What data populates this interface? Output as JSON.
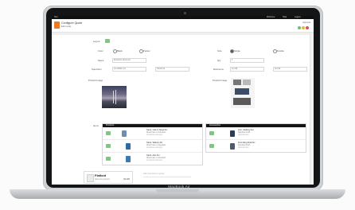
{
  "device": {
    "brand": "MacBook Air"
  },
  "topbar": {
    "left": "Hub",
    "right_items": [
      "Welcome",
      "Help",
      "Logout"
    ]
  },
  "header": {
    "title": "Configure Quote",
    "subtitle": "Edit mode",
    "right_label": "Approval",
    "accent_colors": [
      "#6fbf73",
      "#e6b83a",
      "#d9534f"
    ]
  },
  "form": {
    "row1": {
      "label": "Layout",
      "toggle": ""
    },
    "row2": {
      "label": "Color",
      "options": [
        "Black",
        "Pewter"
      ],
      "right_label": "Size",
      "right_options": [
        "Single",
        "Double"
      ]
    },
    "row3": {
      "label": "Name",
      "value": "Evolution Stool AU",
      "right_label": "Qty",
      "right_value": "1"
    },
    "row4": {
      "label": "Spec/Item",
      "value": "AU-SPEC-01",
      "value2": "TEAK-04",
      "right_label": "Reference",
      "right_value": "AU-08",
      "right_value2": "AU-09"
    },
    "image_label": "Product Image",
    "image_right_label": "Product Image"
  },
  "panels": {
    "options_label": "Items",
    "left": {
      "title": "Products",
      "rows": [
        {
          "name": "Stool, Oak & Steel AU",
          "detail": "Wood base in Standard",
          "sub": "Customer preferred"
        },
        {
          "name": "Stool, Walnut AU",
          "detail": "Wood base in Standard",
          "sub": "Customer preferred"
        },
        {
          "name": "Stool, Ash AU",
          "detail": "Wood base in Standard",
          "sub": "Customer preferred"
        }
      ]
    },
    "right": {
      "title": "Accessories",
      "rows": [
        {
          "name": "Arm, Gliding Set",
          "detail": "Standard finish",
          "sub": "Optional item"
        },
        {
          "name": "Foot Ring Rail AU",
          "detail": "Standard finish",
          "sub": "Optional item"
        }
      ]
    }
  },
  "footer_card": {
    "name": "Flatbed",
    "sub": "Add new product",
    "price": "$1,000"
  },
  "add_more": {
    "label": "Add more items to group"
  }
}
